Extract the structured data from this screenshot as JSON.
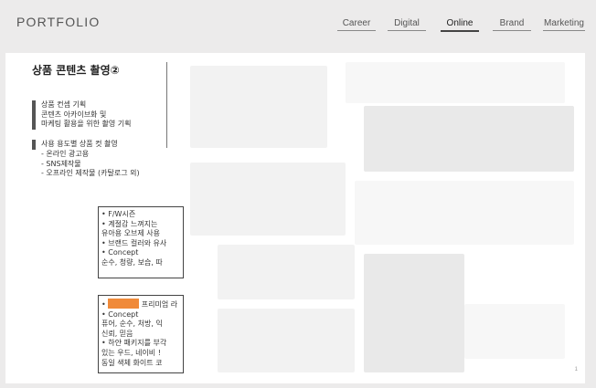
{
  "header": {
    "brand": "PORTFOLIO",
    "nav": [
      "Career",
      "Digital",
      "Online",
      "Brand",
      "Marketing"
    ],
    "active": "Online"
  },
  "slide": {
    "title": "상품 콘텐츠 촬영②",
    "section1": [
      "상품 컨셉 기획",
      "콘텐츠 아카이브화 및",
      "마케팅 활용을 위한 촬영 기획"
    ],
    "section2_head": "사용 용도별 상품 컷 촬영",
    "section2_items": [
      "-  온라인 광고용",
      "-  SNS제작물",
      "-  오프라인 제작물 (카탈로그 외)"
    ],
    "box1": [
      "• F/W시즌",
      "• 계절감 느껴지는",
      "  유아용 오브제 사용",
      "• 브랜드 컬러와 유사",
      "• Concept",
      "  순수, 청량, 보습, 따"
    ],
    "box2_first_suffix": " 프리미엄 라",
    "box2": [
      "• Concept",
      "  퓨어, 순수, 처방, 익",
      "  신뢰, 믿음",
      "• 하얀 패키지를 부각",
      "  있는 우드, 네이비 !",
      "  동일 색체 화이트 코"
    ],
    "page_number": "1"
  },
  "colors": {
    "redaction": "#f08a3a",
    "background": "#ecebeb",
    "card": "#ffffff"
  }
}
